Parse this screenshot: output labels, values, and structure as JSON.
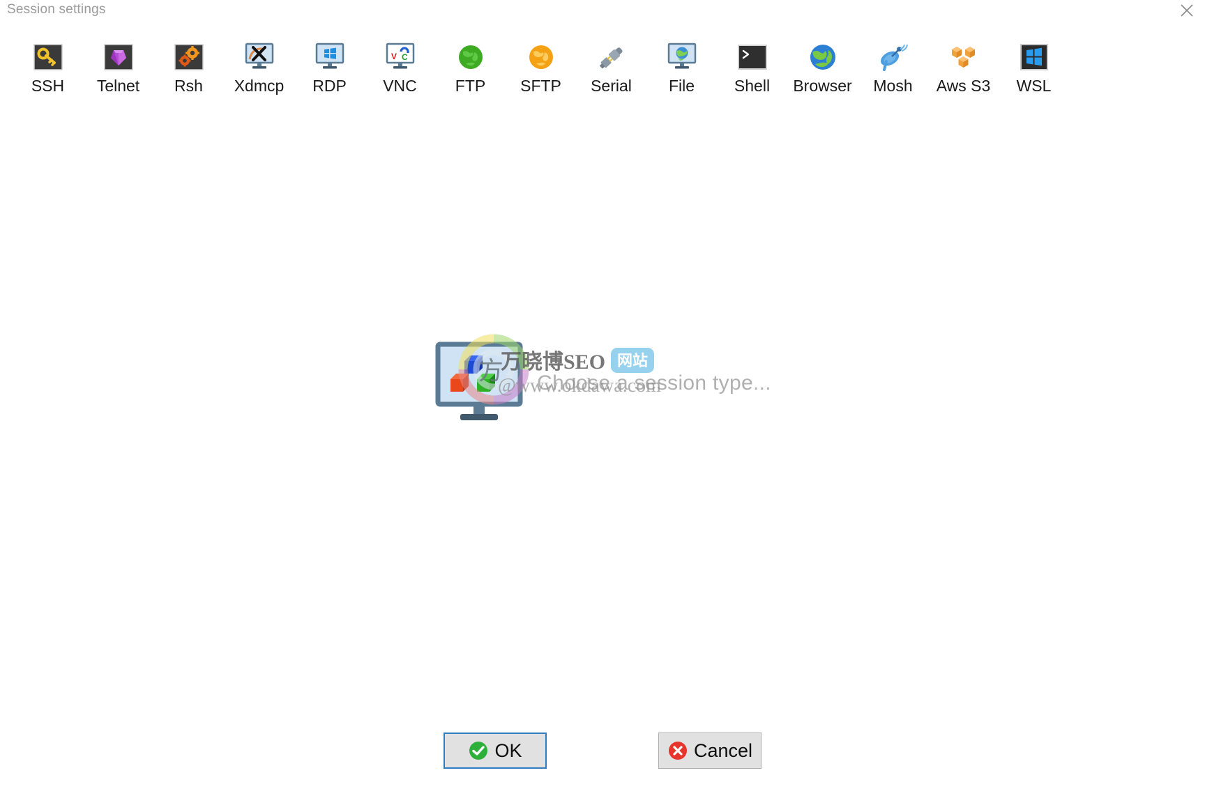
{
  "window": {
    "title": "Session settings",
    "close_icon": "close-icon"
  },
  "session_types": [
    {
      "label": "SSH",
      "icon": "ssh-key-icon"
    },
    {
      "label": "Telnet",
      "icon": "telnet-crystal-icon"
    },
    {
      "label": "Rsh",
      "icon": "rsh-gears-icon"
    },
    {
      "label": "Xdmcp",
      "icon": "xdmcp-monitor-x-icon"
    },
    {
      "label": "RDP",
      "icon": "rdp-monitor-windows-icon"
    },
    {
      "label": "VNC",
      "icon": "vnc-monitor-icon"
    },
    {
      "label": "FTP",
      "icon": "ftp-green-globe-icon"
    },
    {
      "label": "SFTP",
      "icon": "sftp-orange-globe-icon"
    },
    {
      "label": "Serial",
      "icon": "serial-plug-icon"
    },
    {
      "label": "File",
      "icon": "file-monitor-globe-icon"
    },
    {
      "label": "Shell",
      "icon": "shell-terminal-icon"
    },
    {
      "label": "Browser",
      "icon": "browser-globe-icon"
    },
    {
      "label": "Mosh",
      "icon": "mosh-satellite-icon"
    },
    {
      "label": "Aws S3",
      "icon": "aws-s3-cubes-icon"
    },
    {
      "label": "WSL",
      "icon": "wsl-windows-icon"
    }
  ],
  "main": {
    "placeholder_text": "Choose a session type...",
    "placeholder_icon": "monitor-cubes-icon"
  },
  "watermark": {
    "line1": "万晓博SEO",
    "badge": "网站",
    "line2": "@www.okdawa.com"
  },
  "buttons": {
    "ok": {
      "label": "OK",
      "icon": "green-check-icon"
    },
    "cancel": {
      "label": "Cancel",
      "icon": "red-x-icon"
    }
  },
  "colors": {
    "title_text": "#9b9b9b",
    "label_text": "#1a1a1a",
    "placeholder_text": "#b0b0b0",
    "focus_border": "#2f7cc1",
    "button_face": "#e1e1e1",
    "ok_green": "#2cb03a",
    "cancel_red": "#e8352b",
    "badge_blue": "#79c7ea"
  }
}
